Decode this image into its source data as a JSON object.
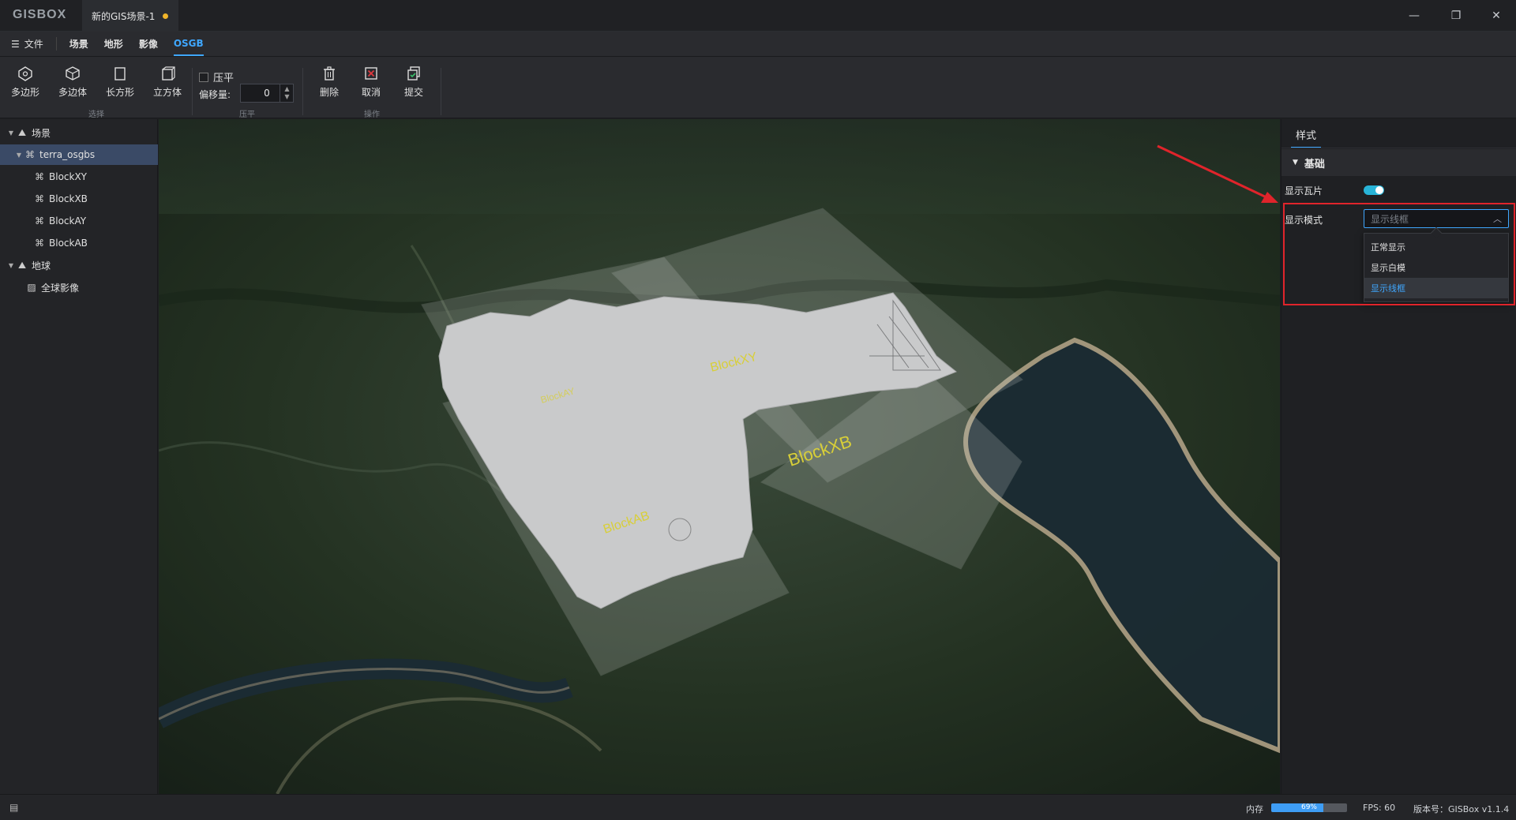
{
  "app": {
    "logo": "GISBOX",
    "doc_tab": "新的GIS场景-1",
    "window_controls": {
      "minimize": "—",
      "maximize": "❐",
      "close": "✕"
    }
  },
  "menu": {
    "file": "文件",
    "tabs": [
      {
        "label": "场景",
        "active": false
      },
      {
        "label": "地形",
        "active": false
      },
      {
        "label": "影像",
        "active": false
      },
      {
        "label": "OSGB",
        "active": true
      }
    ]
  },
  "toolbar": {
    "select_group": {
      "label": "选择",
      "tools": [
        {
          "label": "多边形",
          "icon": "polygon-icon"
        },
        {
          "label": "多边体",
          "icon": "polyhedron-icon"
        },
        {
          "label": "长方形",
          "icon": "rectangle-icon"
        },
        {
          "label": "立方体",
          "icon": "cube-icon"
        }
      ]
    },
    "flatten_group": {
      "label": "压平",
      "checkbox_label": "压平",
      "offset_label": "偏移量:",
      "offset_value": "0"
    },
    "operate_group": {
      "label": "操作",
      "tools": [
        {
          "label": "删除",
          "icon": "trash-icon"
        },
        {
          "label": "取消",
          "icon": "cancel-icon"
        },
        {
          "label": "提交",
          "icon": "submit-icon"
        }
      ]
    }
  },
  "tree": {
    "scene_root": "场景",
    "layer": "terra_osgbs",
    "blocks": [
      "BlockXY",
      "BlockXB",
      "BlockAY",
      "BlockAB"
    ],
    "earth_root": "地球",
    "imagery": "全球影像"
  },
  "viewport": {
    "block_labels": [
      "BlockXY",
      "BlockXB",
      "BlockAB",
      "BlockAY"
    ]
  },
  "props": {
    "tab": "样式",
    "section": "基础",
    "show_tiles_label": "显示瓦片",
    "show_tiles_on": true,
    "display_mode_label": "显示模式",
    "display_mode_value": "显示线框",
    "display_mode_options": [
      "正常显示",
      "显示白模",
      "显示线框"
    ],
    "selected_option_index": 2
  },
  "status": {
    "memory_label": "内存",
    "memory_percent": 69,
    "memory_text": "69%",
    "fps": "FPS: 60",
    "version": "版本号：GISBox v1.1.4"
  },
  "colors": {
    "accent": "#3fa7ff",
    "highlight_red": "#e0242b",
    "toggle_on": "#28b4d8"
  }
}
